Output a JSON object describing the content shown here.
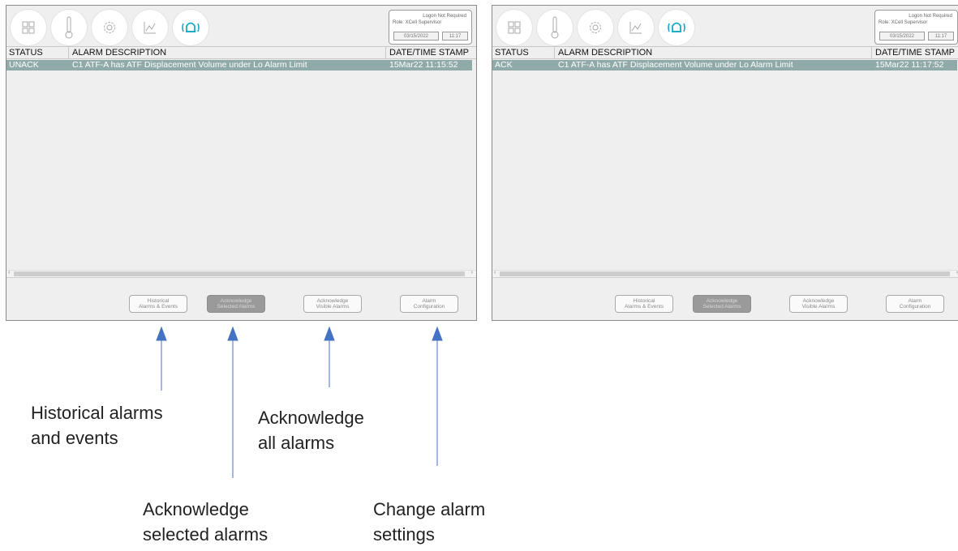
{
  "nav_icons": [
    "grid-icon",
    "thermometer-icon",
    "gear-icon",
    "chart-icon",
    "alarm-bell-icon"
  ],
  "colors": {
    "active_icon": "#19a8c8",
    "selected_row": "#8faaa9",
    "arrow": "#4472c4"
  },
  "table_headers": {
    "status": "STATUS",
    "description": "ALARM DESCRIPTION",
    "timestamp": "DATE/TIME STAMP"
  },
  "left_panel": {
    "login_status": "Logon Not Required",
    "role": "Role: XCell Supervisor",
    "date": "03/15/2022",
    "time": "11:17",
    "row": {
      "status": "UNACK",
      "description": "C1 ATF-A has ATF Displacement Volume under Lo Alarm Limit",
      "timestamp": "15Mar22 11:15:52"
    }
  },
  "right_panel": {
    "login_status": "Logon Not Required",
    "role": "Role: XCell Supervisor",
    "date": "03/15/2022",
    "time": "11:17",
    "row": {
      "status": "ACK",
      "description": "C1 ATF-A has ATF Displacement Volume under Lo Alarm Limit",
      "timestamp": "15Mar22 11:17:52"
    }
  },
  "buttons": {
    "historical": [
      "Historical",
      "Alarms & Events"
    ],
    "ack_selected": [
      "Acknowledge",
      "Selected Alarms"
    ],
    "ack_visible": [
      "Acknowledge",
      "Visible Alarms"
    ],
    "config": [
      "Alarm",
      "Configuration"
    ]
  },
  "callouts": {
    "historical": [
      "Historical alarms",
      "and events"
    ],
    "ack_all": [
      "Acknowledge",
      "all alarms"
    ],
    "ack_selected": [
      "Acknowledge",
      "selected alarms"
    ],
    "settings": [
      "Change alarm",
      "settings"
    ]
  }
}
